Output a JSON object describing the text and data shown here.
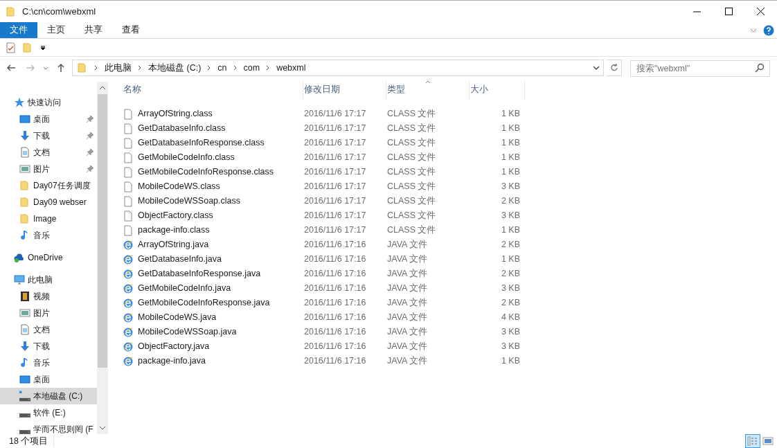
{
  "window": {
    "title": "C:\\cn\\com\\webxml"
  },
  "ribbon_tabs": [
    {
      "label": "文件",
      "selected": true
    },
    {
      "label": "主页",
      "selected": false
    },
    {
      "label": "共享",
      "selected": false
    },
    {
      "label": "查看",
      "selected": false
    }
  ],
  "address": {
    "crumbs": [
      "此电脑",
      "本地磁盘 (C:)",
      "cn",
      "com",
      "webxml"
    ]
  },
  "search": {
    "placeholder": "搜索\"webxml\""
  },
  "sidebar": {
    "items": [
      {
        "label": "快速访问",
        "kind": "star",
        "selected": false,
        "children": [
          {
            "label": "桌面",
            "kind": "desktop",
            "pinned": true,
            "selected": false
          },
          {
            "label": "下载",
            "kind": "download",
            "pinned": true,
            "selected": false
          },
          {
            "label": "文档",
            "kind": "document",
            "pinned": true,
            "selected": false
          },
          {
            "label": "图片",
            "kind": "picture",
            "pinned": true,
            "selected": false
          },
          {
            "label": "Day07任务调度",
            "kind": "folder",
            "pinned": false,
            "selected": false
          },
          {
            "label": "Day09 webser",
            "kind": "folder",
            "pinned": false,
            "selected": false
          },
          {
            "label": "Image",
            "kind": "folder",
            "pinned": false,
            "selected": false
          },
          {
            "label": "音乐",
            "kind": "music",
            "pinned": false,
            "selected": false
          }
        ]
      },
      {
        "label": "OneDrive",
        "kind": "cloud",
        "selected": false
      },
      {
        "label": "此电脑",
        "kind": "pc",
        "selected": false,
        "children": [
          {
            "label": "视频",
            "kind": "video",
            "pinned": false,
            "selected": false
          },
          {
            "label": "图片",
            "kind": "picture",
            "pinned": false,
            "selected": false
          },
          {
            "label": "文档",
            "kind": "document",
            "pinned": false,
            "selected": false
          },
          {
            "label": "下载",
            "kind": "download",
            "pinned": false,
            "selected": false
          },
          {
            "label": "音乐",
            "kind": "music",
            "pinned": false,
            "selected": false
          },
          {
            "label": "桌面",
            "kind": "desktop",
            "pinned": false,
            "selected": false
          },
          {
            "label": "本地磁盘 (C:)",
            "kind": "systemdrive",
            "pinned": false,
            "selected": true
          },
          {
            "label": "软件 (E:)",
            "kind": "drive",
            "pinned": false,
            "selected": false
          },
          {
            "label": "学而不思则罔 (F",
            "kind": "drive",
            "pinned": false,
            "selected": false
          }
        ]
      }
    ]
  },
  "table": {
    "columns": [
      {
        "label": "名称",
        "sorted": false
      },
      {
        "label": "修改日期",
        "sorted": false
      },
      {
        "label": "类型",
        "sorted": true
      },
      {
        "label": "大小",
        "sorted": false
      }
    ],
    "rows": [
      {
        "kind": "class",
        "name": "ArrayOfString.class",
        "date": "2016/11/6 17:17",
        "type": "CLASS 文件",
        "size": "1 KB"
      },
      {
        "kind": "class",
        "name": "GetDatabaseInfo.class",
        "date": "2016/11/6 17:17",
        "type": "CLASS 文件",
        "size": "1 KB"
      },
      {
        "kind": "class",
        "name": "GetDatabaseInfoResponse.class",
        "date": "2016/11/6 17:17",
        "type": "CLASS 文件",
        "size": "1 KB"
      },
      {
        "kind": "class",
        "name": "GetMobileCodeInfo.class",
        "date": "2016/11/6 17:17",
        "type": "CLASS 文件",
        "size": "1 KB"
      },
      {
        "kind": "class",
        "name": "GetMobileCodeInfoResponse.class",
        "date": "2016/11/6 17:17",
        "type": "CLASS 文件",
        "size": "1 KB"
      },
      {
        "kind": "class",
        "name": "MobileCodeWS.class",
        "date": "2016/11/6 17:17",
        "type": "CLASS 文件",
        "size": "3 KB"
      },
      {
        "kind": "class",
        "name": "MobileCodeWSSoap.class",
        "date": "2016/11/6 17:17",
        "type": "CLASS 文件",
        "size": "2 KB"
      },
      {
        "kind": "class",
        "name": "ObjectFactory.class",
        "date": "2016/11/6 17:17",
        "type": "CLASS 文件",
        "size": "3 KB"
      },
      {
        "kind": "class",
        "name": "package-info.class",
        "date": "2016/11/6 17:17",
        "type": "CLASS 文件",
        "size": "1 KB"
      },
      {
        "kind": "java",
        "name": "ArrayOfString.java",
        "date": "2016/11/6 17:16",
        "type": "JAVA 文件",
        "size": "2 KB"
      },
      {
        "kind": "java",
        "name": "GetDatabaseInfo.java",
        "date": "2016/11/6 17:16",
        "type": "JAVA 文件",
        "size": "1 KB"
      },
      {
        "kind": "java",
        "name": "GetDatabaseInfoResponse.java",
        "date": "2016/11/6 17:16",
        "type": "JAVA 文件",
        "size": "2 KB"
      },
      {
        "kind": "java",
        "name": "GetMobileCodeInfo.java",
        "date": "2016/11/6 17:16",
        "type": "JAVA 文件",
        "size": "3 KB"
      },
      {
        "kind": "java",
        "name": "GetMobileCodeInfoResponse.java",
        "date": "2016/11/6 17:16",
        "type": "JAVA 文件",
        "size": "2 KB"
      },
      {
        "kind": "java",
        "name": "MobileCodeWS.java",
        "date": "2016/11/6 17:16",
        "type": "JAVA 文件",
        "size": "4 KB"
      },
      {
        "kind": "java",
        "name": "MobileCodeWSSoap.java",
        "date": "2016/11/6 17:16",
        "type": "JAVA 文件",
        "size": "3 KB"
      },
      {
        "kind": "java",
        "name": "ObjectFactory.java",
        "date": "2016/11/6 17:16",
        "type": "JAVA 文件",
        "size": "3 KB"
      },
      {
        "kind": "java",
        "name": "package-info.java",
        "date": "2016/11/6 17:16",
        "type": "JAVA 文件",
        "size": "1 KB"
      }
    ]
  },
  "status_bar": {
    "count": "18 个项目",
    "views": [
      {
        "kind": "details",
        "selected": true
      },
      {
        "kind": "large",
        "selected": false
      }
    ]
  }
}
